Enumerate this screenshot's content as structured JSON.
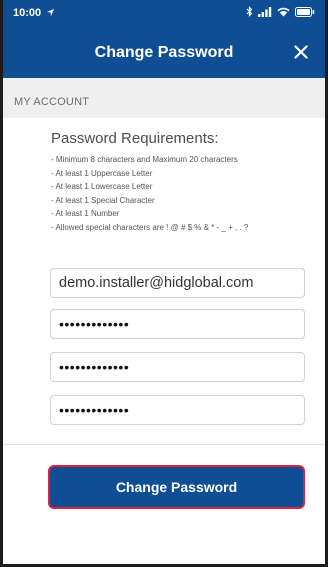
{
  "status_bar": {
    "time": "10:00",
    "location_icon": "location-arrow-icon",
    "bluetooth_icon": "bluetooth-icon",
    "signal_icon": "signal-icon",
    "wifi_icon": "wifi-icon",
    "battery_icon": "battery-icon"
  },
  "header": {
    "title": "Change Password",
    "close_icon": "close-icon",
    "background_color": "#0f4e93"
  },
  "section": {
    "title": "MY ACCOUNT"
  },
  "requirements": {
    "title": "Password Requirements:",
    "lines": [
      "- Minimum 8 characters and Maximum 20 characters",
      "- At least 1 Uppercase Letter",
      "- At least 1 Lowercase Letter",
      "- At least 1 Special Character",
      "- At least 1 Number",
      "- Allowed special characters are ! @ # $ % & * - _ + , . ?"
    ]
  },
  "form": {
    "email_value": "demo.installer@hidglobal.com",
    "current_password_value": "•••••••••••••",
    "new_password_value": "•••••••••••••",
    "confirm_password_value": "•••••••••••••"
  },
  "action": {
    "submit_label": "Change Password",
    "button_color": "#0f4e93",
    "focus_border_color": "#e0213a"
  }
}
